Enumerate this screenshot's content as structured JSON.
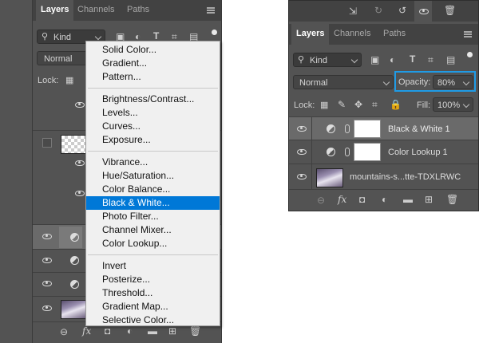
{
  "left_panel": {
    "tabs": [
      "Layers",
      "Channels",
      "Paths"
    ],
    "kind_label": "Kind",
    "blend_mode": "Normal",
    "lock_label": "Lock:"
  },
  "adjustment_menu": {
    "groups": [
      [
        "Solid Color...",
        "Gradient...",
        "Pattern..."
      ],
      [
        "Brightness/Contrast...",
        "Levels...",
        "Curves...",
        "Exposure..."
      ],
      [
        "Vibrance...",
        "Hue/Saturation...",
        "Color Balance...",
        "Black & White...",
        "Photo Filter...",
        "Channel Mixer...",
        "Color Lookup..."
      ],
      [
        "Invert",
        "Posterize...",
        "Threshold...",
        "Gradient Map...",
        "Selective Color..."
      ]
    ],
    "selected": "Black & White..."
  },
  "right_panel": {
    "tabs": [
      "Layers",
      "Channels",
      "Paths"
    ],
    "kind_label": "Kind",
    "blend_mode": "Normal",
    "opacity_label": "Opacity:",
    "opacity_value": "80%",
    "lock_label": "Lock:",
    "fill_label": "Fill:",
    "fill_value": "100%",
    "layers": [
      {
        "name": "Black & White 1",
        "selected": true
      },
      {
        "name": "Color Lookup 1",
        "selected": false
      },
      {
        "name": "mountains-s...tte-TDXLRWC",
        "selected": false
      }
    ]
  },
  "colors": {
    "panel": "#535353",
    "selection_blue": "#0078d7",
    "highlight_outline": "#1f9be6"
  }
}
